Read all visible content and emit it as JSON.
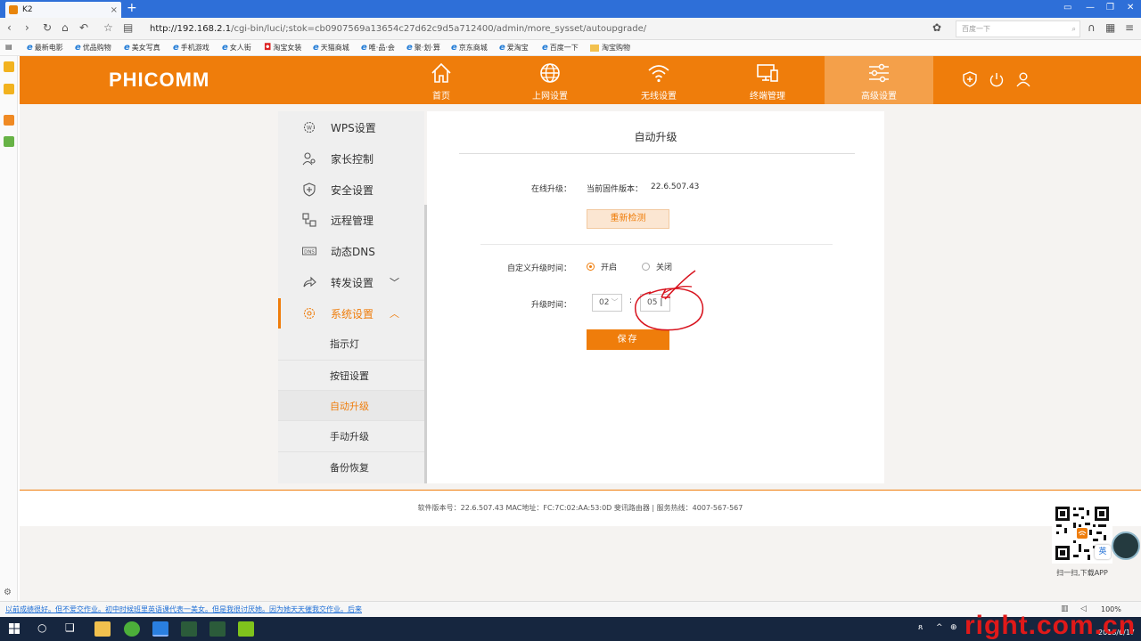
{
  "browser": {
    "tab_title": "K2",
    "tab_close": "×",
    "new_tab": "+",
    "url_host": "http://192.168.2.1",
    "url_path": "/cgi-bin/luci/;stok=cb0907569a13654c27d62c9d5a712400/admin/more_sysset/autoupgrade/",
    "search_placeholder": "百度一下",
    "bookmarks": [
      "最新电影",
      "优品购物",
      "美女写真",
      "手机游戏",
      "女人街",
      "淘宝女装",
      "天猫商城",
      "唯·品·会",
      "聚·划·算",
      "京东商城",
      "爱淘宝",
      "百度一下",
      "淘宝购物"
    ]
  },
  "router": {
    "logo": "PHICOMM",
    "nav": [
      {
        "label": "首页",
        "icon": "home-icon"
      },
      {
        "label": "上网设置",
        "icon": "globe-icon"
      },
      {
        "label": "无线设置",
        "icon": "wifi-icon"
      },
      {
        "label": "终端管理",
        "icon": "devices-icon"
      },
      {
        "label": "高级设置",
        "icon": "sliders-icon"
      }
    ],
    "header_icons": [
      "shield-plus-icon",
      "power-icon",
      "user-icon"
    ]
  },
  "sidemenu": {
    "items": [
      {
        "label": "WPS设置",
        "icon": "gear-w-icon"
      },
      {
        "label": "家长控制",
        "icon": "parent-icon"
      },
      {
        "label": "安全设置",
        "icon": "shield-icon"
      },
      {
        "label": "远程管理",
        "icon": "remote-icon"
      },
      {
        "label": "动态DNS",
        "icon": "dns-icon"
      },
      {
        "label": "转发设置",
        "icon": "forward-icon"
      },
      {
        "label": "系统设置",
        "icon": "system-gear-icon"
      }
    ],
    "sub": [
      "指示灯",
      "按钮设置",
      "自动升级",
      "手动升级",
      "备份恢复"
    ],
    "chevron_down": "﹀",
    "chevron_up": "︿"
  },
  "panel": {
    "title": "自动升级",
    "online_label": "在线升级：",
    "firmware_label": "当前固件版本：",
    "firmware_version": "22.6.507.43",
    "recheck": "重新检测",
    "custom_time_label": "自定义升级时间：",
    "on": "开启",
    "off": "关闭",
    "upgrade_time_label": "升级时间：",
    "hour": "02",
    "minute": "05",
    "colon": ":",
    "save": "保存"
  },
  "footer": {
    "text": "软件版本号：22.6.507.43    MAC地址：FC:7C:02:AA:53:0D    斐讯路由器 | 服务热线：4007-567-567",
    "qr_caption": "扫一扫,下载APP",
    "ime": "英"
  },
  "statusbar": {
    "news": "以前成绩很好。但不爱交作业。初中时候班里英语课代表一美女。但是我很讨厌她。因为她天天催我交作业。后来",
    "zoom": "100%"
  },
  "taskbar": {
    "date": "2018/6/17"
  },
  "watermark": "right.com.cn",
  "colors": {
    "accent": "#ef7d0b",
    "accent_light": "#f4a04a"
  }
}
